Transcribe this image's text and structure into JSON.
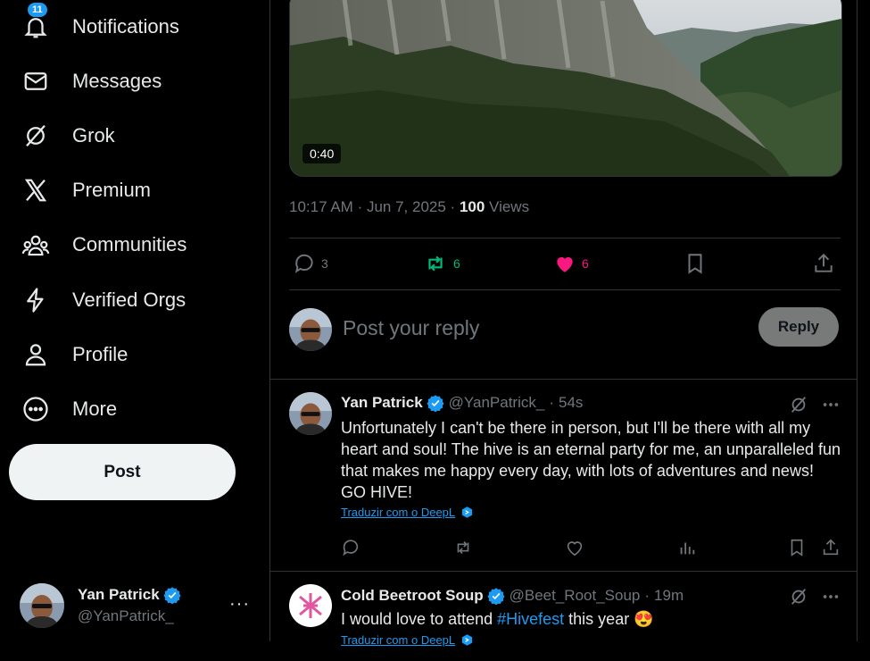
{
  "sidebar": {
    "items": [
      {
        "label": "Notifications",
        "badge": "11"
      },
      {
        "label": "Messages"
      },
      {
        "label": "Grok"
      },
      {
        "label": "Premium"
      },
      {
        "label": "Communities"
      },
      {
        "label": "Verified Orgs"
      },
      {
        "label": "Profile"
      },
      {
        "label": "More"
      }
    ],
    "post_label": "Post",
    "account": {
      "name": "Yan Patrick",
      "handle": "@YanPatrick_",
      "more": "···"
    }
  },
  "main_tweet": {
    "video_duration": "0:40",
    "time": "10:17 AM",
    "date": "Jun 7, 2025",
    "views_count": "100",
    "views_label": "Views",
    "replies": "3",
    "reposts": "6",
    "likes": "6"
  },
  "reply_box": {
    "placeholder": "Post your reply",
    "button": "Reply"
  },
  "replies": [
    {
      "name": "Yan Patrick",
      "handle": "@YanPatrick_",
      "time": "54s",
      "text": "Unfortunately I can't be there in person, but I'll be there with all my heart and soul! The hive is an eternal party for me, an unparalleled fun that makes me happy every day, with lots of adventures and news! GO HIVE!",
      "translate": "Traduzir com o DeepL"
    },
    {
      "name": "Cold Beetroot Soup",
      "handle": "@Beet_Root_Soup",
      "time": "19m",
      "text_before": "I would love to attend ",
      "hashtag": "#Hivefest",
      "text_after": " this year ",
      "emoji": "😍",
      "translate": "Traduzir com o DeepL"
    }
  ],
  "colors": {
    "accent": "#1d9bf0",
    "repost": "#00ba7c",
    "like": "#f91880",
    "muted": "#71767b",
    "border": "#2f3336"
  }
}
